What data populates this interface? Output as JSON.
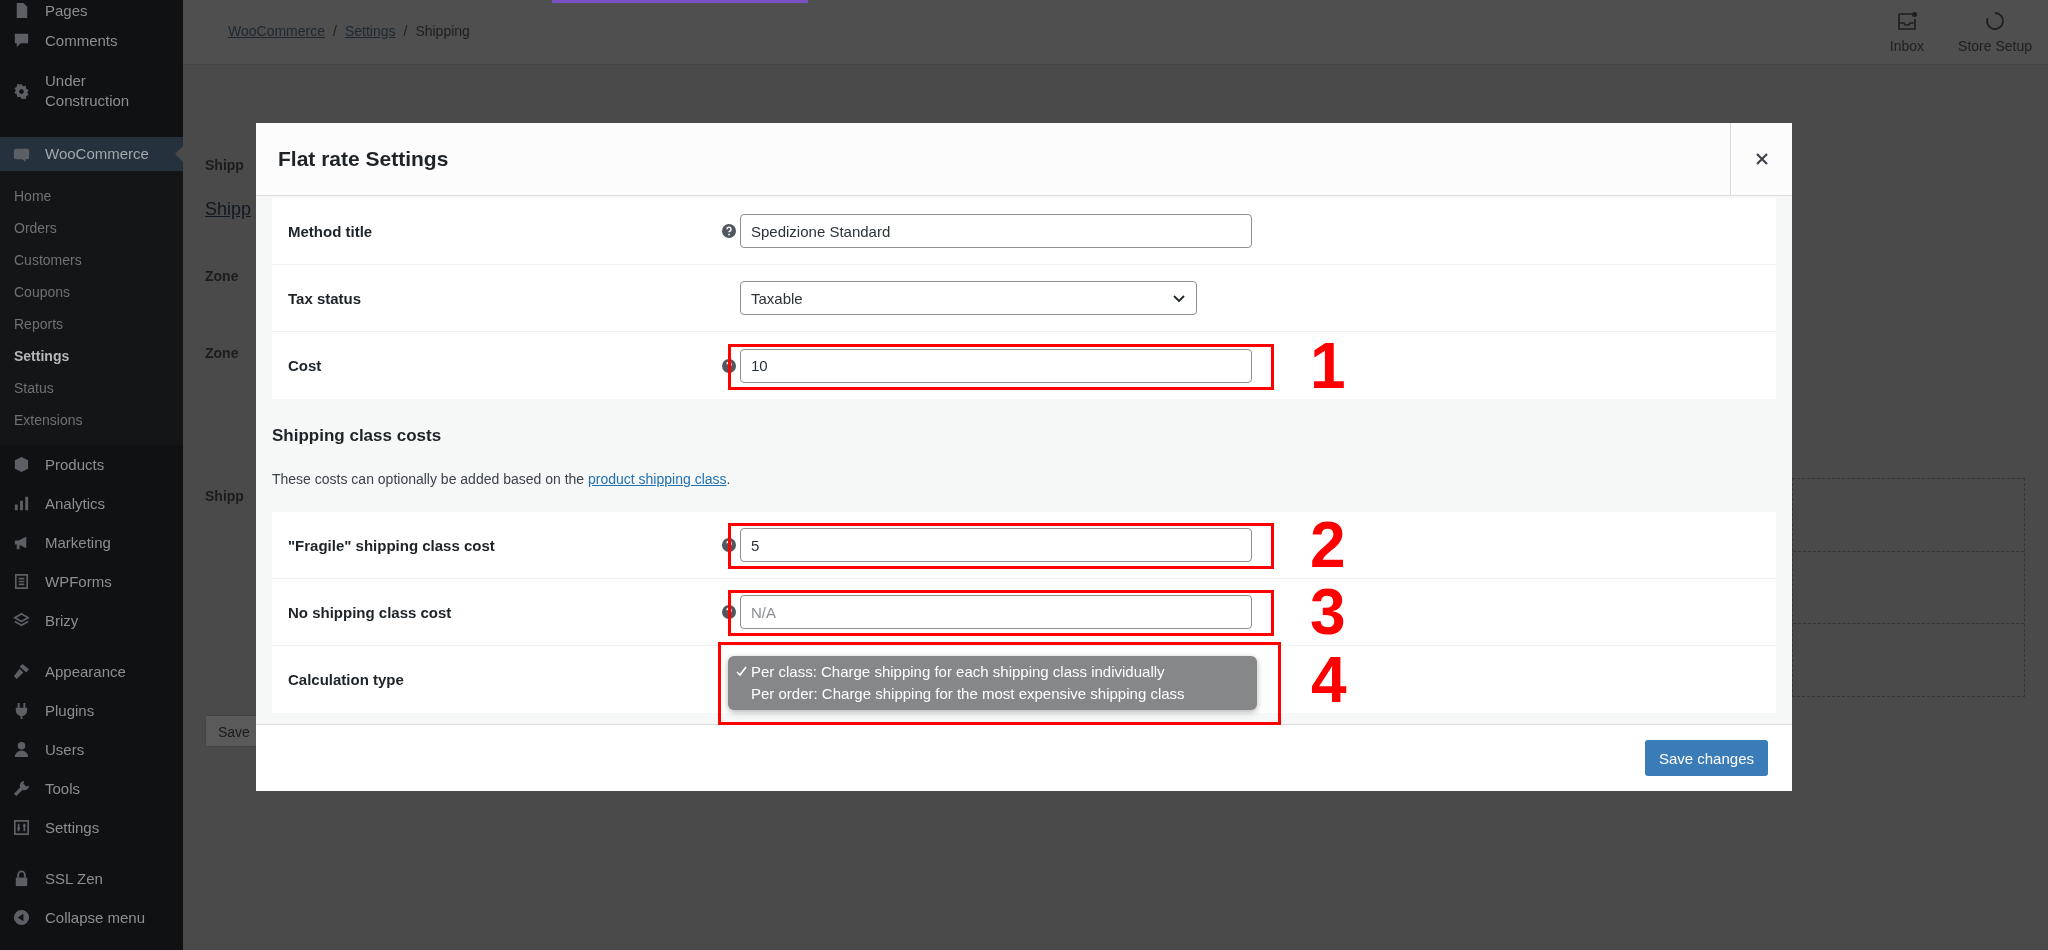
{
  "sidebar": {
    "items": [
      {
        "label": "Pages",
        "selected": false
      },
      {
        "label": "Comments",
        "selected": false
      },
      {
        "label": "Under Construction",
        "selected": false
      },
      {
        "label": "WooCommerce",
        "selected": true,
        "children": [
          {
            "label": "Home",
            "selected": false
          },
          {
            "label": "Orders",
            "selected": false
          },
          {
            "label": "Customers",
            "selected": false
          },
          {
            "label": "Coupons",
            "selected": false
          },
          {
            "label": "Reports",
            "selected": false
          },
          {
            "label": "Settings",
            "selected": true
          },
          {
            "label": "Status",
            "selected": false
          },
          {
            "label": "Extensions",
            "selected": false
          }
        ]
      },
      {
        "label": "Products",
        "selected": false
      },
      {
        "label": "Analytics",
        "selected": false
      },
      {
        "label": "Marketing",
        "selected": false
      },
      {
        "label": "WPForms",
        "selected": false
      },
      {
        "label": "Brizy",
        "selected": false
      },
      {
        "label": "Appearance",
        "selected": false
      },
      {
        "label": "Plugins",
        "selected": false
      },
      {
        "label": "Users",
        "selected": false
      },
      {
        "label": "Tools",
        "selected": false
      },
      {
        "label": "Settings",
        "selected": false
      },
      {
        "label": "SSL Zen",
        "selected": false
      },
      {
        "label": "Collapse menu",
        "selected": false
      }
    ]
  },
  "breadcrumb": {
    "separator": "/",
    "items": [
      {
        "label": "WooCommerce",
        "kind": "link"
      },
      {
        "label": "Settings",
        "kind": "link"
      },
      {
        "label": "Shipping",
        "kind": "current"
      }
    ]
  },
  "toolbar": [
    {
      "label": "Inbox"
    },
    {
      "label": "Store Setup"
    }
  ],
  "background": [
    {
      "text": "Shipp",
      "kind": "heading"
    },
    {
      "text": "Shipp",
      "kind": "link"
    },
    {
      "text": "Zone",
      "kind": "label"
    },
    {
      "text": "Zone",
      "kind": "label"
    },
    {
      "text": "Shipp",
      "kind": "label"
    },
    {
      "text": "Save",
      "kind": "button"
    }
  ],
  "modal": {
    "title": "Flat rate Settings",
    "fields": [
      {
        "label": "Method title",
        "kind": "text",
        "help": true,
        "value": "Spedizione Standard"
      },
      {
        "label": "Tax status",
        "kind": "select",
        "help": false,
        "value": "Taxable"
      },
      {
        "label": "Cost",
        "kind": "text",
        "help": true,
        "value": "10",
        "annotation": "1"
      }
    ],
    "section": {
      "title": "Shipping class costs",
      "description_before": "These costs can optionally be added based on the ",
      "link": "product shipping class",
      "description_after": "."
    },
    "class_fields": [
      {
        "label": "\"Fragile\" shipping class cost",
        "kind": "text",
        "help": true,
        "value": "5",
        "annotation": "2"
      },
      {
        "label": "No shipping class cost",
        "kind": "text",
        "help": true,
        "placeholder": "N/A",
        "annotation": "3"
      },
      {
        "label": "Calculation type",
        "kind": "dropdown",
        "help": false,
        "annotation": "4",
        "options": [
          {
            "label": "Per class: Charge shipping for each shipping class individually",
            "selected": true
          },
          {
            "label": "Per order: Charge shipping for the most expensive shipping class",
            "selected": false
          }
        ]
      }
    ],
    "save_button": "Save changes"
  }
}
